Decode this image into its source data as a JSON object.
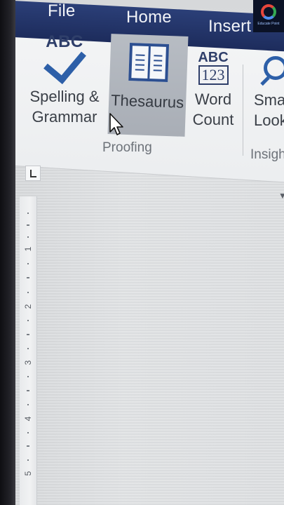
{
  "menu": {
    "tabs": [
      "File",
      "Home",
      "Insert"
    ]
  },
  "logo": {
    "text": "Educate Point"
  },
  "ribbon": {
    "spelling": {
      "icon_text": "ABC",
      "label_line1": "Spelling &",
      "label_line2": "Grammar"
    },
    "thesaurus": {
      "label": "Thesaurus"
    },
    "word_count": {
      "icon_top": "ABC",
      "icon_bottom": "123",
      "label_line1": "Word",
      "label_line2": "Count"
    },
    "smart_lookup": {
      "label_line1": "Sma",
      "label_line2": "Looku"
    },
    "groups": {
      "proofing": "Proofing",
      "insights": "Insigh"
    }
  },
  "ruler": {
    "numbers": [
      "1",
      "2",
      "3",
      "4",
      "5"
    ]
  },
  "colors": {
    "title_bar": "#1d2c5c",
    "accent_blue": "#2d5fa8",
    "selected_button": "#a9aeb6"
  }
}
